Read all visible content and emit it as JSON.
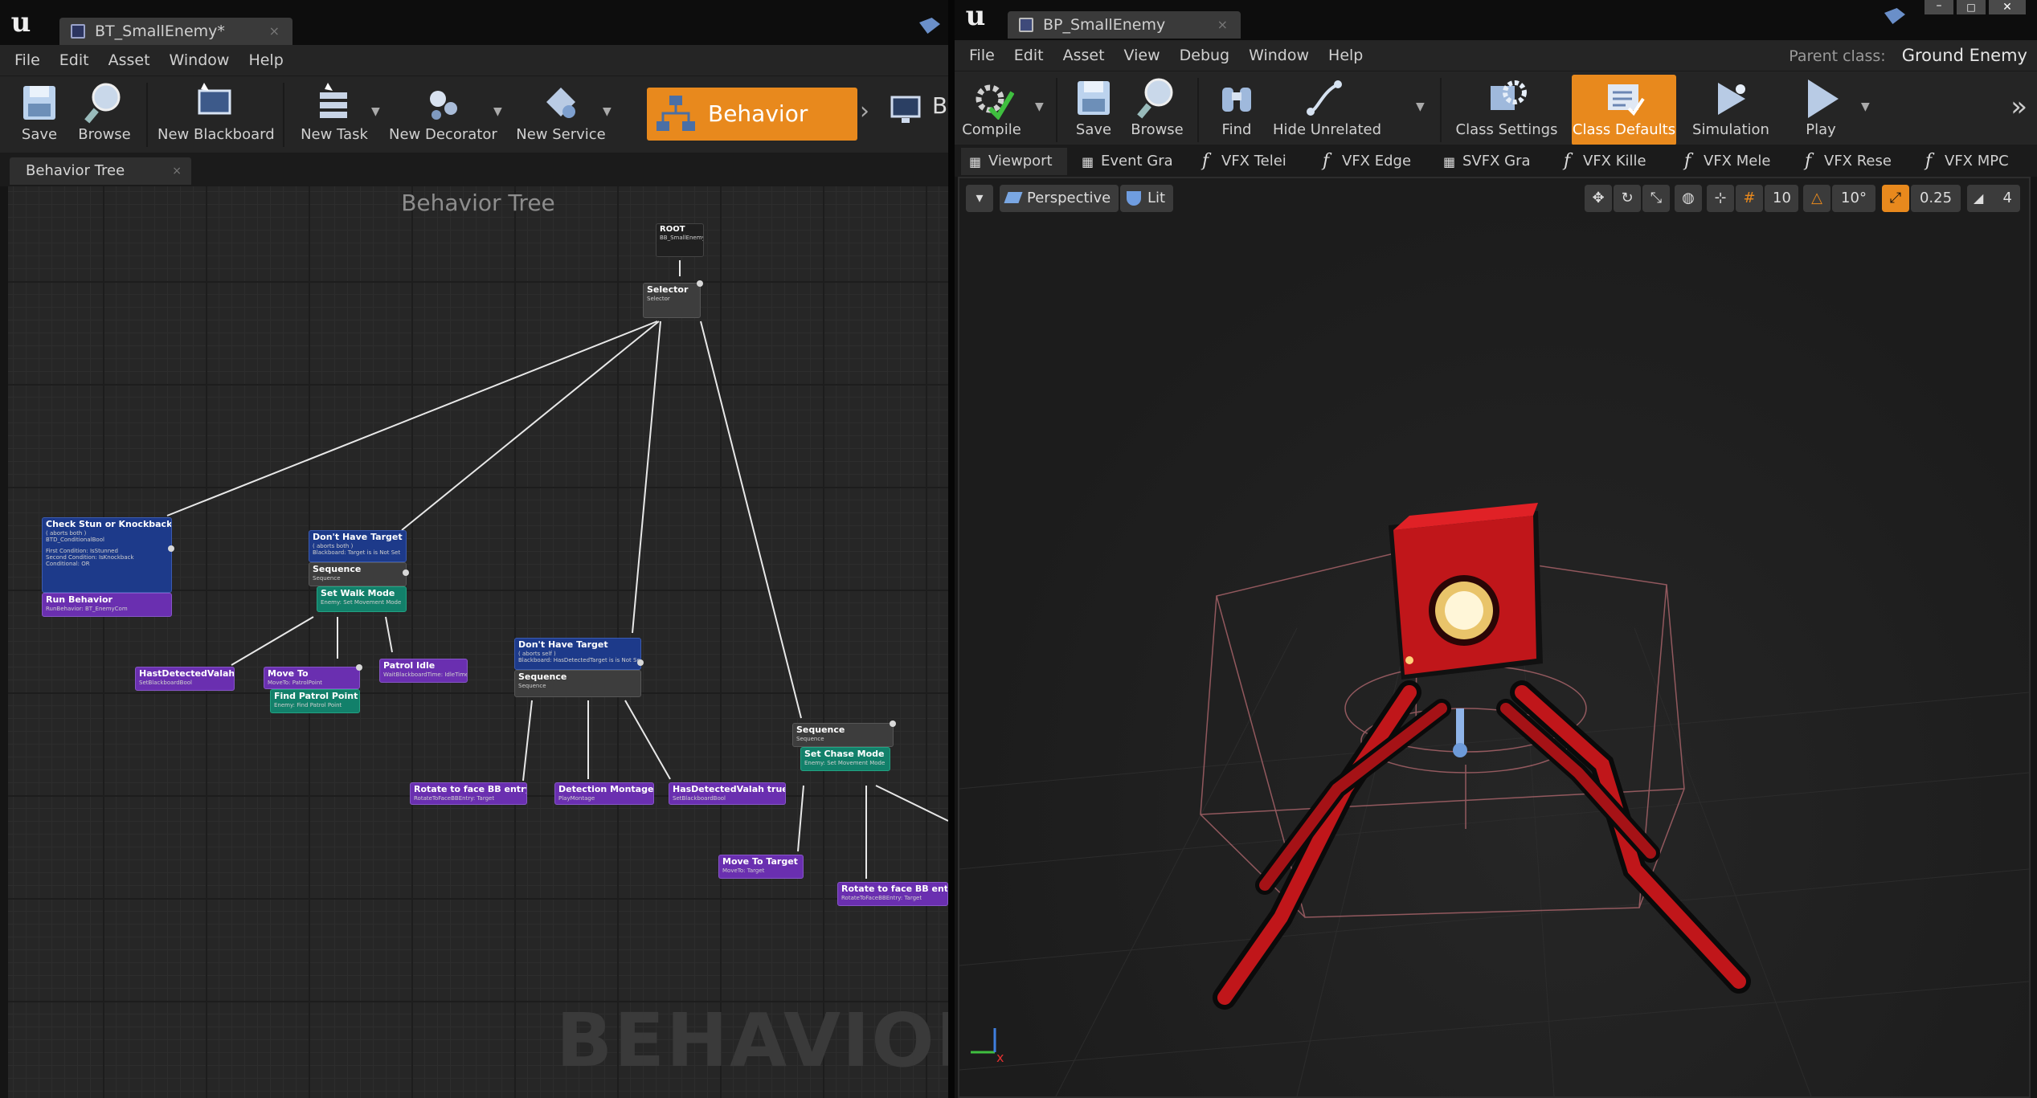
{
  "left_window": {
    "tab_title": "BT_SmallEnemy*",
    "menu": [
      "File",
      "Edit",
      "Asset",
      "Window",
      "Help"
    ],
    "toolbar": {
      "save": "Save",
      "browse": "Browse",
      "new_blackboard": "New Blackboard",
      "new_task": "New Task",
      "new_decorator": "New Decorator",
      "new_service": "New Service",
      "mode_behavior_tree": "Behavior Tree",
      "mode_blackboard_partial": "B"
    },
    "panel_tab": "Behavior Tree",
    "graph_title": "Behavior Tree",
    "watermark": "BEHAVIOR TI",
    "nodes": {
      "root": {
        "title": "ROOT",
        "sub": "BB_SmallEnemy"
      },
      "selector": {
        "title": "Selector",
        "sub": "Selector"
      },
      "check_stun": {
        "title": "Check Stun or Knockback",
        "sub1": "( aborts both )",
        "sub2": "BTD_ConditionalBool",
        "sub3": "First Condition: IsStunned",
        "sub4": "Second Condition: IsKnockback",
        "sub5": "Conditional: OR"
      },
      "run_behavior": {
        "title": "Run Behavior",
        "sub": "RunBehavior: BT_EnemyCom"
      },
      "dont_have_target_1": {
        "title": "Don't Have Target",
        "sub1": "( aborts both )",
        "sub2": "Blackboard: Target is is Not Set"
      },
      "sequence_1": {
        "title": "Sequence",
        "sub": "Sequence"
      },
      "set_walk_mode": {
        "title": "Set Walk Mode",
        "sub": "Enemy: Set Movement Mode"
      },
      "has_detected_1": {
        "title": "HastDetectedValah",
        "sub": "SetBlackboardBool"
      },
      "move_to_1": {
        "title": "Move To",
        "sub": "MoveTo: PatrolPoint"
      },
      "find_patrol": {
        "title": "Find Patrol Point",
        "sub": "Enemy: Find Patrol Point"
      },
      "patrol_idle": {
        "title": "Patrol Idle",
        "sub": "WaitBlackboardTime: IdleTime"
      },
      "dont_have_target_2": {
        "title": "Don't Have Target",
        "sub1": "( aborts self )",
        "sub2": "Blackboard: HasDetectedTarget is is Not Set"
      },
      "sequence_2": {
        "title": "Sequence",
        "sub": "Sequence"
      },
      "rotate_1": {
        "title": "Rotate to face BB entry",
        "sub": "RotateToFaceBBEntry: Target"
      },
      "detection_montage": {
        "title": "Detection Montage",
        "sub": "PlayMontage"
      },
      "has_detected_2": {
        "title": "HasDetectedValah true",
        "sub": "SetBlackboardBool"
      },
      "sequence_3": {
        "title": "Sequence",
        "sub": "Sequence"
      },
      "set_chase_mode": {
        "title": "Set Chase Mode",
        "sub": "Enemy: Set Movement Mode"
      },
      "move_to_target": {
        "title": "Move To Target",
        "sub": "MoveTo: Target"
      },
      "rotate_2": {
        "title": "Rotate to face BB entry",
        "sub": "RotateToFaceBBEntry: Target"
      }
    }
  },
  "right_window": {
    "tab_title": "BP_SmallEnemy",
    "menu": [
      "File",
      "Edit",
      "Asset",
      "View",
      "Debug",
      "Window",
      "Help"
    ],
    "parent_class_label": "Parent class:",
    "parent_class_value": "Ground Enemy",
    "toolbar": {
      "compile": "Compile",
      "save": "Save",
      "browse": "Browse",
      "find": "Find",
      "hide_unrelated": "Hide Unrelated",
      "class_settings": "Class Settings",
      "class_defaults": "Class Defaults",
      "simulation": "Simulation",
      "play": "Play"
    },
    "tabs": [
      "Viewport",
      "Event Gra",
      "VFX Telei",
      "VFX Edge",
      "SVFX Gra",
      "VFX Kille",
      "VFX Mele",
      "VFX Rese",
      "VFX MPC"
    ],
    "viewport": {
      "perspective": "Perspective",
      "lit": "Lit",
      "grid_snap": "10",
      "rot_snap": "10°",
      "scale_snap": "0.25",
      "cam_speed": "4"
    }
  },
  "colors": {
    "accent_orange": "#e8891d",
    "task_purple": "#6a2fb0",
    "decorator_blue": "#1d3a8a",
    "service_green": "#12806a",
    "robot_red": "#c0161a"
  }
}
